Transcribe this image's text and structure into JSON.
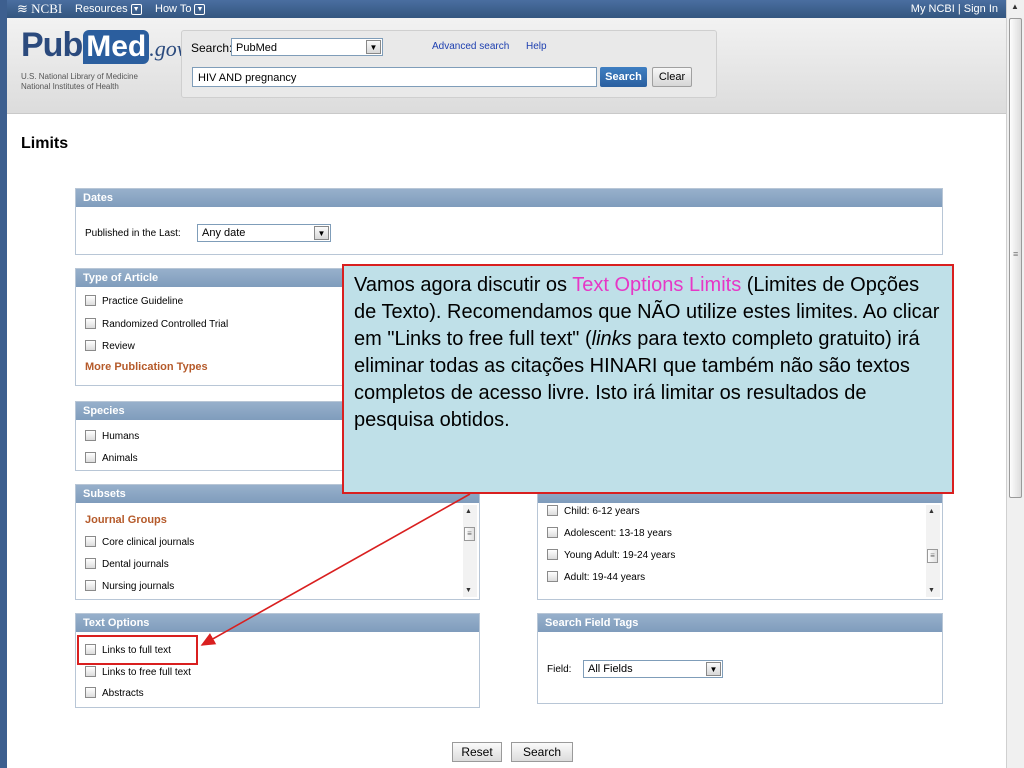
{
  "ncbi_bar": {
    "logo": "NCBI",
    "resources": "Resources",
    "howto": "How To",
    "account": "My NCBI | Sign In"
  },
  "header": {
    "logo_pub": "Pub",
    "logo_med": "Med",
    "logo_gov": ".gov",
    "subtitle_1": "U.S. National Library of Medicine",
    "subtitle_2": "National Institutes of Health",
    "search_label": "Search:",
    "database": "PubMed",
    "advanced": "Advanced search",
    "help": "Help",
    "query": "HIV AND pregnancy",
    "search_button": "Search",
    "clear_button": "Clear"
  },
  "page_title": "Limits",
  "dates": {
    "title": "Dates",
    "label": "Published in the Last:",
    "value": "Any date"
  },
  "type_of_article": {
    "title": "Type of Article",
    "items": [
      "Practice Guideline",
      "Randomized Controlled Trial",
      "Review"
    ],
    "more": "More Publication Types"
  },
  "species": {
    "title": "Species",
    "items": [
      "Humans",
      "Animals"
    ]
  },
  "subsets": {
    "title": "Subsets",
    "group": "Journal Groups",
    "items": [
      "Core clinical journals",
      "Dental journals",
      "Nursing journals"
    ]
  },
  "ages": {
    "items": [
      "Child: 6-12 years",
      "Adolescent: 13-18 years",
      "Young Adult: 19-24 years",
      "Adult: 19-44 years"
    ]
  },
  "text_options": {
    "title": "Text Options",
    "items": [
      "Links to full text",
      "Links to free full text",
      "Abstracts"
    ]
  },
  "search_field_tags": {
    "title": "Search Field Tags",
    "label": "Field:",
    "value": "All Fields"
  },
  "footer": {
    "reset": "Reset",
    "search": "Search"
  },
  "callout": {
    "part1": "Vamos agora discutir os ",
    "highlight": "Text Options Limits",
    "part2": " (Limites de Opções de Texto). Recomendamos que NÃO utilize estes limites. Ao clicar em \"Links to free full text\" (",
    "links_word": "links",
    "part3": " para texto completo gratuito) irá eliminar todas as citações HINARI que também não são textos completos de acesso livre. Isto irá limitar os resultados de pesquisa obtidos."
  },
  "colors": {
    "callout_bg": "#bfe0e8",
    "callout_border": "#d91f1f",
    "callout_highlight": "#e637c6",
    "box_header": "#8aa6c4",
    "ncbi_bar": "#3f6494"
  }
}
